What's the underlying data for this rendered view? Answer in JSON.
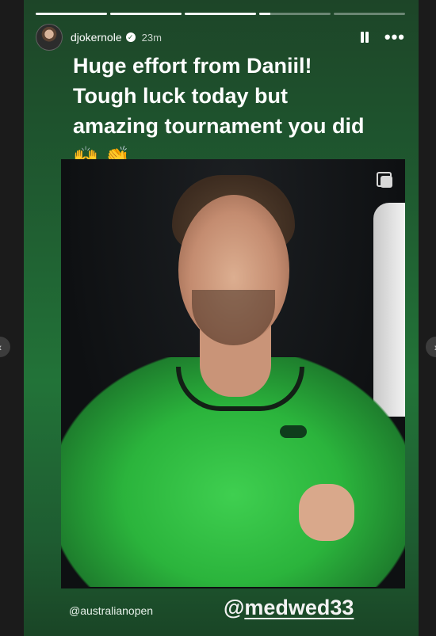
{
  "story": {
    "progress": [
      1.0,
      1.0,
      1.0,
      0.16,
      0.0
    ],
    "username": "djokernole",
    "verified_icon": "verified-badge-icon",
    "time_ago": "23m",
    "pause_icon": "pause-icon",
    "more_icon": "more-options-icon",
    "more_glyph": "•••"
  },
  "caption": {
    "lines": [
      "Huge effort from Daniil!",
      "Tough luck today but",
      "amazing tournament you did"
    ],
    "emoji": "🙌 👏"
  },
  "photo": {
    "icon": "multiple-images-icon"
  },
  "tags": {
    "source": "@australianopen",
    "mention_at": "@",
    "mention_handle": "medwed33"
  },
  "navigation": {
    "prev_glyph": "‹",
    "next_glyph": "›"
  },
  "colors": {
    "background": "#1b1b1b",
    "story_green": "#227338",
    "text": "#ffffff"
  }
}
